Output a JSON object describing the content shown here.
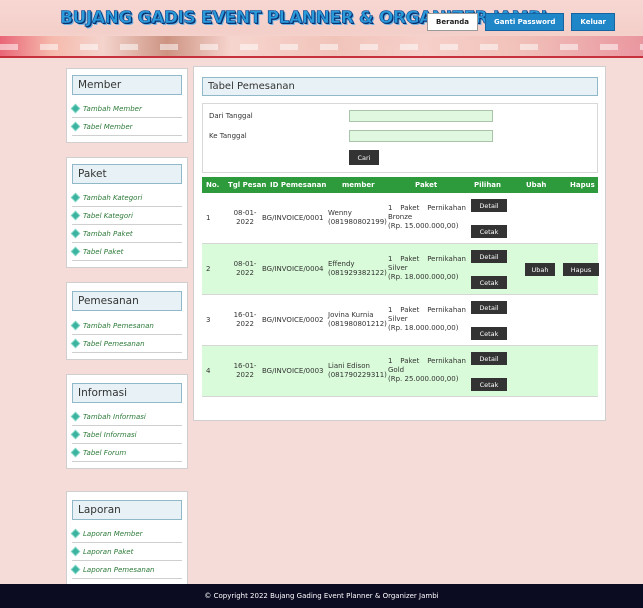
{
  "header": {
    "site_title": "BUJANG GADIS EVENT PLANNER & ORGANIZER JAMBI",
    "nav": {
      "beranda": "Beranda",
      "ganti_password": "Ganti Password",
      "keluar": "Keluar"
    }
  },
  "sidebar": {
    "member": {
      "title": "Member",
      "items": [
        "Tambah Member",
        "Tabel Member"
      ]
    },
    "paket": {
      "title": "Paket",
      "items": [
        "Tambah Kategori",
        "Tabel Kategori",
        "Tambah Paket",
        "Tabel Paket"
      ]
    },
    "pemesanan": {
      "title": "Pemesanan",
      "items": [
        "Tambah Pemesanan",
        "Tabel Pemesanan"
      ]
    },
    "informasi": {
      "title": "Informasi",
      "items": [
        "Tambah Informasi",
        "Tabel Informasi",
        "Tabel Forum"
      ]
    },
    "laporan": {
      "title": "Laporan",
      "items": [
        "Laporan Member",
        "Laporan Paket",
        "Laporan Pemesanan"
      ]
    }
  },
  "main": {
    "title": "Tabel Pemesanan",
    "filter": {
      "dari_label": "Dari Tanggal",
      "ke_label": "Ke Tanggal",
      "dari_value": "",
      "ke_value": "",
      "cari_label": "Cari"
    },
    "table": {
      "headers": {
        "no": "No.",
        "tgl": "Tgl Pesan",
        "id": "ID Pemesanan",
        "member": "member",
        "paket": "Paket",
        "pilihan": "Pilihan",
        "ubah": "Ubah",
        "hapus": "Hapus"
      },
      "rows": [
        {
          "no": "1",
          "tgl1": "08-01-",
          "tgl2": "2022",
          "id": "BG/INVOICE/0001",
          "name": "Wenny",
          "phone": "(081980802199)",
          "pkt_a": "1",
          "pkt_b": "Paket",
          "pkt_c": "Pernikahan",
          "pkt_tier": "Bronze",
          "price": "(Rp. 15.000.000,00)"
        },
        {
          "no": "2",
          "tgl1": "08-01-",
          "tgl2": "2022",
          "id": "BG/INVOICE/0004",
          "name": "Effendy",
          "phone": "(081929382122)",
          "pkt_a": "1",
          "pkt_b": "Paket",
          "pkt_c": "Pernikahan",
          "pkt_tier": "Silver",
          "price": "(Rp. 18.000.000,00)"
        },
        {
          "no": "3",
          "tgl1": "16-01-",
          "tgl2": "2022",
          "id": "BG/INVOICE/0002",
          "name": "Jovina Kurnia",
          "phone": "(081980801212)",
          "pkt_a": "1",
          "pkt_b": "Paket",
          "pkt_c": "Pernikahan",
          "pkt_tier": "Silver",
          "price": "(Rp. 18.000.000,00)"
        },
        {
          "no": "4",
          "tgl1": "16-01-",
          "tgl2": "2022",
          "id": "BG/INVOICE/0003",
          "name": "Liani Edison",
          "phone": "(081790229311)",
          "pkt_a": "1",
          "pkt_b": "Paket",
          "pkt_c": "Pernikahan",
          "pkt_tier": "Gold",
          "price": "(Rp. 25.000.000,00)"
        }
      ],
      "detail_label": "Detail",
      "cetak_label": "Cetak",
      "ubah_label": "Ubah",
      "hapus_label": "Hapus"
    }
  },
  "footer": {
    "text": "© Copyright 2022 Bujang Gading Event Planner & Organizer Jambi"
  }
}
